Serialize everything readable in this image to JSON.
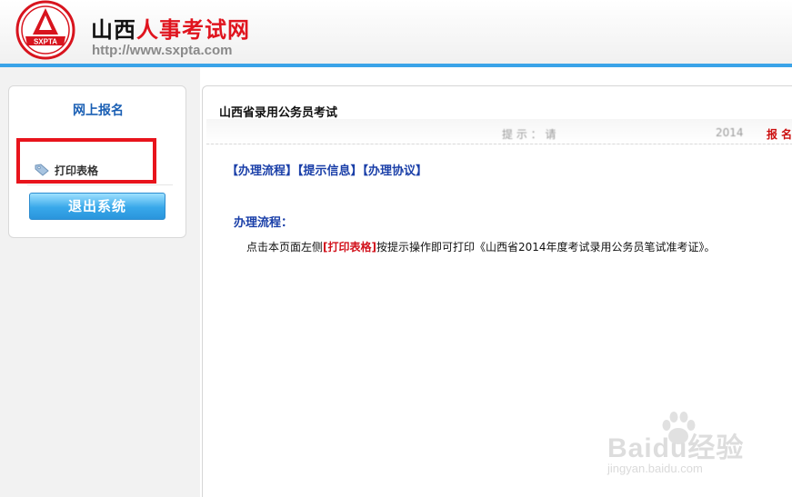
{
  "header": {
    "logo_text": "SXPTA",
    "site_title_black": "山西",
    "site_title_red": "人事考试网",
    "site_url": "http://www.sxpta.com"
  },
  "sidebar": {
    "title": "网上报名",
    "menu_items": [
      {
        "label": "打印表格",
        "icon": "tag-icon"
      }
    ],
    "logout_label": "退出系统"
  },
  "main": {
    "title": "山西省录用公务员考试",
    "marquee": {
      "left": "提 示 ：  请",
      "right": "2014",
      "red": "报 名号"
    },
    "tabs": [
      "【办理流程】",
      "【提示信息】",
      "【办理协议】"
    ],
    "section_title": "办理流程：",
    "instruction": {
      "before": "点击本页面左侧",
      "highlight": "[打印表格]",
      "after": "按提示操作即可打印《山西省2014年度考试录用公务员笔试准考证》。"
    }
  },
  "watermark": {
    "text": "Baidu经验",
    "url": "jingyan.baidu.com"
  },
  "colors": {
    "accent_blue": "#3aa3e8",
    "title_red": "#e0141e",
    "link_blue": "#1a3fa8",
    "highlight_box": "#e8141c"
  }
}
